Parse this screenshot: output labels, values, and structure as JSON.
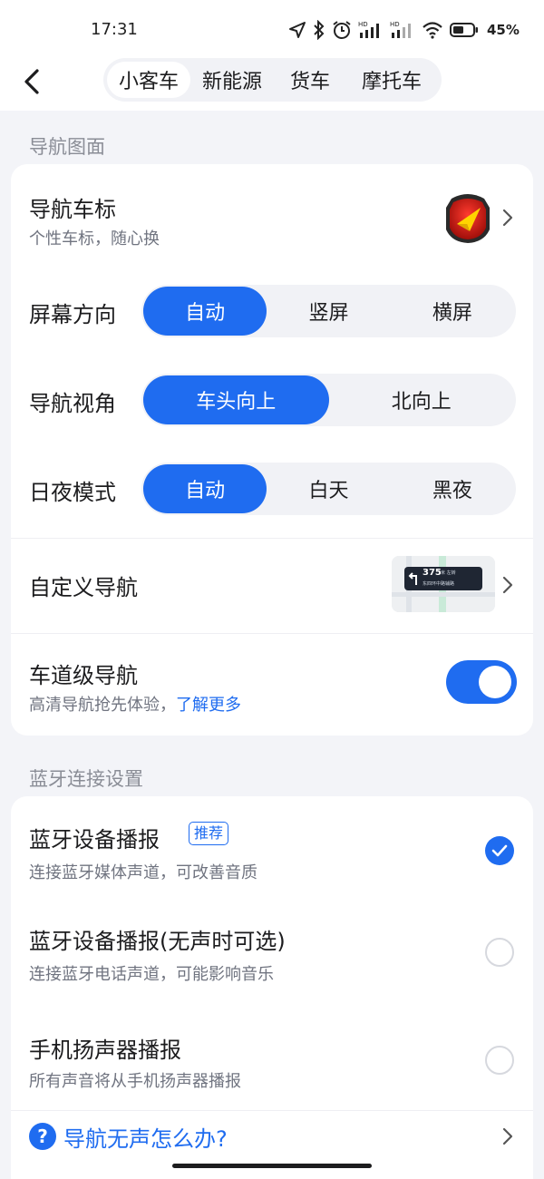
{
  "status_bar": {
    "time": "17:31",
    "battery": "45%",
    "icons": [
      "location-icon",
      "bluetooth-icon",
      "alarm-icon",
      "signal-hd-icon",
      "signal-hd-icon",
      "wifi-icon",
      "battery-icon"
    ]
  },
  "header": {
    "back_icon": "chevron-left-icon",
    "tabs": [
      {
        "label": "小客车",
        "active": true
      },
      {
        "label": "新能源",
        "active": false
      },
      {
        "label": "货车",
        "active": false
      },
      {
        "label": "摩托车",
        "active": false
      }
    ]
  },
  "nav_display": {
    "section_title": "导航图面",
    "vehicle_icon": {
      "title": "导航车标",
      "subtitle": "个性车标，随心换"
    },
    "screen_orientation": {
      "title": "屏幕方向",
      "options": [
        "自动",
        "竖屏",
        "横屏"
      ],
      "selected": "自动"
    },
    "view_angle": {
      "title": "导航视角",
      "options": [
        "车头向上",
        "北向上"
      ],
      "selected": "车头向上"
    },
    "day_night": {
      "title": "日夜模式",
      "options": [
        "自动",
        "白天",
        "黑夜"
      ],
      "selected": "自动"
    },
    "custom_nav": {
      "title": "自定义导航",
      "thumb_distance": "375",
      "thumb_unit": "米 左转",
      "thumb_road": "东四环中路辅路"
    },
    "lane_nav": {
      "title": "车道级导航",
      "subtitle": "高清导航抢先体验，",
      "link": "了解更多",
      "enabled": true
    }
  },
  "bluetooth": {
    "section_title": "蓝牙连接设置",
    "options": [
      {
        "title": "蓝牙设备播报",
        "badge": "推荐",
        "subtitle": "连接蓝牙媒体声道，可改善音质",
        "checked": true
      },
      {
        "title": "蓝牙设备播报(无声时可选)",
        "subtitle": "连接蓝牙电话声道，可能影响音乐",
        "checked": false
      },
      {
        "title": "手机扬声器播报",
        "subtitle": "所有声音将从手机扬声器播报",
        "checked": false
      }
    ],
    "help_link": "导航无声怎么办?"
  },
  "colors": {
    "accent": "#1f6cf0",
    "background": "#f3f4f8",
    "card": "#ffffff"
  }
}
